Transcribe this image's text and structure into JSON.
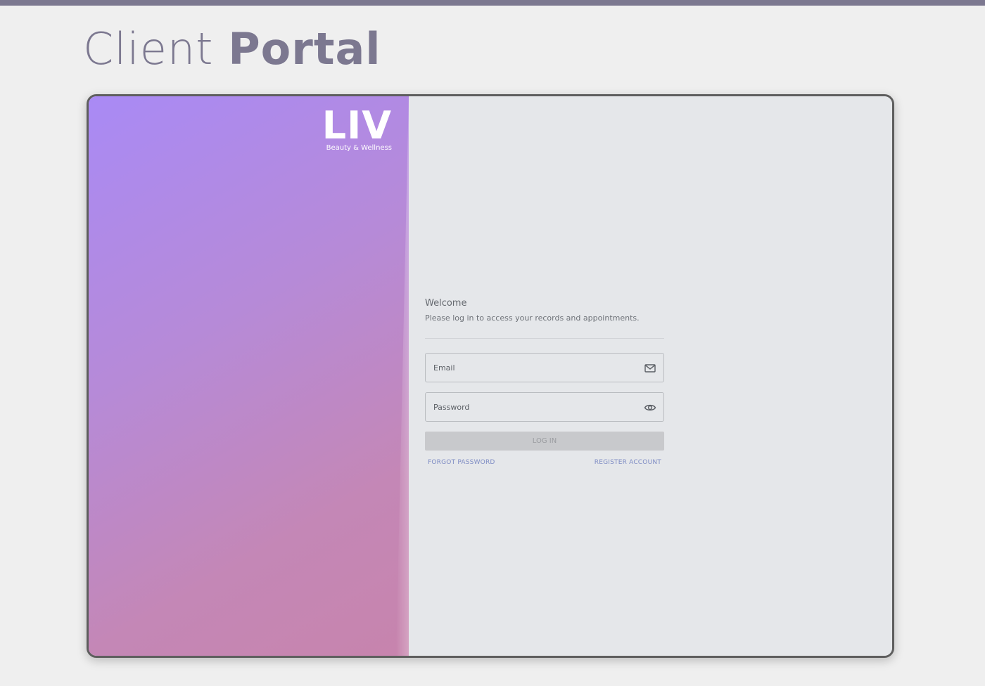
{
  "page": {
    "title_light": "Client ",
    "title_bold": "Portal"
  },
  "brand": {
    "logo_text": "LIV",
    "tagline": "Beauty & Wellness"
  },
  "login": {
    "heading": "Welcome",
    "subheading": "Please log in to access your records and appointments.",
    "email_placeholder": "Email",
    "email_value": "",
    "password_placeholder": "Password",
    "password_value": "",
    "login_label": "LOG IN",
    "forgot_label": "FORGOT PASSWORD",
    "register_label": "REGISTER ACCOUNT"
  },
  "icons": {
    "email": "mail-icon",
    "password": "eye-icon"
  },
  "colors": {
    "accent": "#7c7890",
    "gradient_start": "#a98af5",
    "gradient_end": "#c784ad",
    "link": "#7e8cc4",
    "button_disabled": "#c8c9cc"
  }
}
